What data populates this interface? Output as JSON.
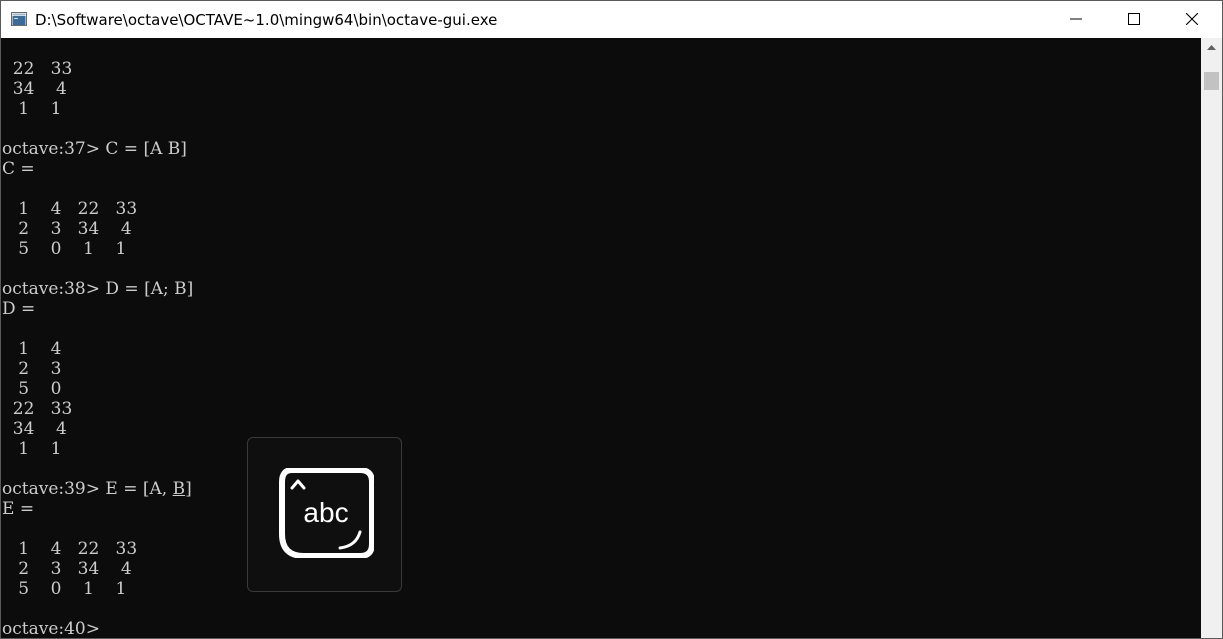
{
  "window": {
    "title": "D:\\Software\\octave\\OCTAVE~1.0\\mingw64\\bin\\octave-gui.exe",
    "icon": "console-window-icon",
    "controls": {
      "minimize_icon": "minimize-icon",
      "maximize_icon": "maximize-icon",
      "close_icon": "close-icon"
    }
  },
  "console": {
    "text_color": "#cccccc",
    "background_color": "#0c0c0c",
    "lines": [
      "  22   33",
      "  34    4",
      "   1    1",
      "",
      "octave:37> C = [A B]",
      "C =",
      "",
      "   1    4   22   33",
      "   2    3   34    4",
      "   5    0    1    1",
      "",
      "octave:38> D = [A; B]",
      "D =",
      "",
      "   1    4",
      "   2    3",
      "   5    0",
      "  22   33",
      "  34    4",
      "   1    1",
      "",
      "octave:39> E = [A, B]",
      "E =",
      "",
      "   1    4   22   33",
      "   2    3   34    4",
      "   5    0    1    1",
      "",
      "octave:40>"
    ]
  },
  "ime_popup": {
    "icon": "ime-abc-icon",
    "label": "abc"
  },
  "scrollbar": {
    "up_icon": "scroll-up-arrow-icon"
  }
}
